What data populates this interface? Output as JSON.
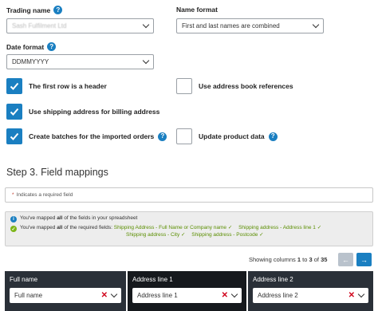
{
  "trading_name": {
    "label": "Trading name",
    "value": "Sash Fulfilment Ltd"
  },
  "name_format": {
    "label": "Name format",
    "value": "First and last names are combined"
  },
  "date_format": {
    "label": "Date format",
    "value": "DDMMYYYY"
  },
  "options": {
    "first_row_header": {
      "label": "The first row is a header",
      "checked": true
    },
    "use_address_book": {
      "label": "Use address book references",
      "checked": false
    },
    "shipping_for_billing": {
      "label": "Use shipping address for billing address",
      "checked": true
    },
    "create_batches": {
      "label": "Create batches for the imported orders",
      "checked": true
    },
    "update_product": {
      "label": "Update product data",
      "checked": false
    }
  },
  "step3": {
    "title": "Step 3. Field mappings",
    "required_note": "Indicates a required field",
    "required_star": "*",
    "mapped_all_prefix": "You've mapped ",
    "mapped_all_bold": "all",
    "mapped_all_suffix": " of the fields in your spreadsheet",
    "mapped_req_prefix": "You've mapped ",
    "mapped_req_bold": "all",
    "mapped_req_suffix": " of the required fields:",
    "required_fields": [
      "Shipping Address - Full Name or Company name ✓",
      "Shipping address - Address line 1 ✓",
      "Shipping address - City ✓",
      "Shipping address - Postcode ✓"
    ]
  },
  "pager": {
    "prefix": "Showing columns ",
    "from": "1",
    "to_word": " to ",
    "to": "3",
    "of_word": " of ",
    "total": "35",
    "prev": "←",
    "next": "→"
  },
  "columns": [
    {
      "header": "Full name",
      "mapping": "Full name"
    },
    {
      "header": "Address line 1",
      "mapping": "Address line 1"
    },
    {
      "header": "Address line 2",
      "mapping": "Address line 2"
    }
  ],
  "colors": {
    "accent": "#1a7fc1",
    "success": "#7cb518",
    "error": "#d0021b",
    "dark_header": "#2a3038"
  }
}
